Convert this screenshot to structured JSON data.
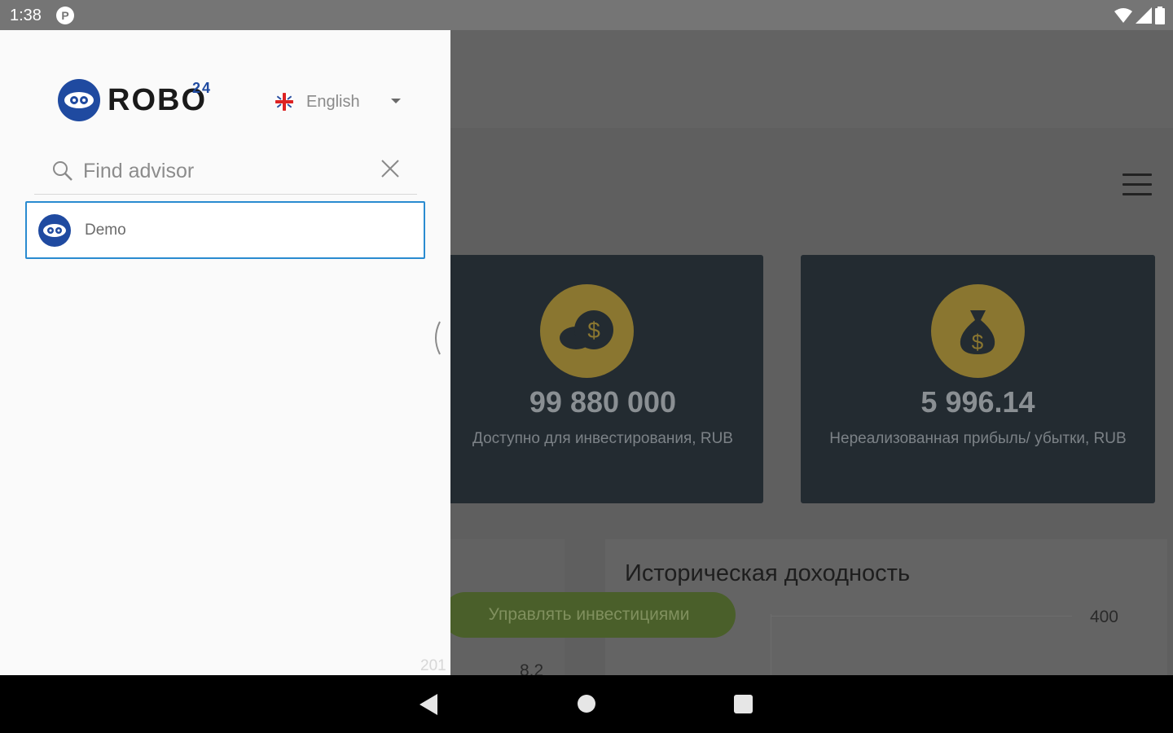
{
  "status_bar": {
    "time": "1:38",
    "notification_icon": "p-icon",
    "system_icons": [
      "wifi-icon",
      "signal-icon",
      "battery-icon"
    ]
  },
  "drawer": {
    "logo": {
      "text": "ROBO",
      "superscript": "24",
      "icon": "eye-logo-icon",
      "brand_color": "#1f4aa0"
    },
    "language": {
      "label": "English",
      "icon": "uk-flag-icon"
    },
    "search": {
      "placeholder": "Find advisor",
      "value": ""
    },
    "advisors": [
      {
        "name": "Demo",
        "icon": "eye-logo-icon"
      }
    ],
    "footer_text": "201",
    "selection_color": "#2a8bd0"
  },
  "background_app": {
    "cards": [
      {
        "value": "99 880 000",
        "label": "Доступно для инвестирования, RUB",
        "icon": "coins-dollar-icon"
      },
      {
        "value": "5 996.14",
        "label": "Нереализованная прибыль/ убытки, RUB",
        "icon": "money-bag-icon"
      }
    ],
    "manage_button": "Управлять инвестициями",
    "history": {
      "title": "Историческая доходность",
      "tick_top": "400"
    },
    "partial_tick": "8.2",
    "accent_gold": "#8a7630",
    "accent_green": "#4a5f2a"
  },
  "nav_bar": {
    "buttons": [
      "back-icon",
      "home-icon",
      "recents-icon"
    ]
  }
}
